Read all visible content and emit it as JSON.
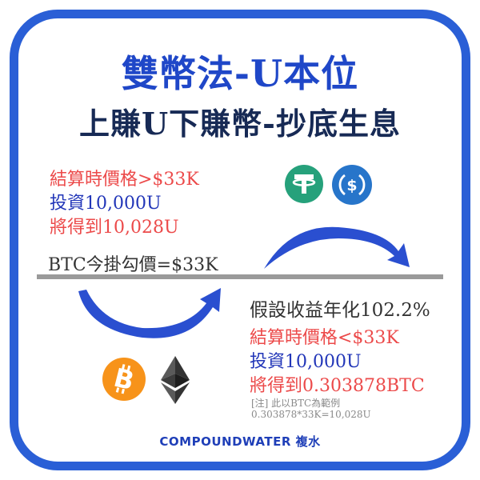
{
  "title": "雙幣法-U本位",
  "subtitle": "上賺U下賺幣-抄底生息",
  "upper": {
    "condition": "結算時價格>$33K",
    "invest": "投資10,000U",
    "result": "將得到10,028U"
  },
  "strike_label": "BTC今掛勾價=$33K",
  "apy_label": "假設收益年化102.2%",
  "lower": {
    "condition": "結算時價格<$33K",
    "invest": "投資10,000U",
    "result": "將得到0.303878BTC"
  },
  "note": {
    "line1": "[注] 此以BTC為範例",
    "line2": "0.303878*33K=10,028U"
  },
  "brand": "COMPOUNDWATER 複水",
  "icons": [
    "tether-icon",
    "usdc-icon",
    "bitcoin-icon",
    "ethereum-icon"
  ],
  "colors": {
    "frame": "#2a5fd6",
    "title": "#1f47c8",
    "subtitle": "#172a55",
    "red": "#ec4a4a",
    "blue": "#2236b8",
    "tether": "#26a17b",
    "usdc": "#2775ca",
    "bitcoin": "#f7931a"
  }
}
